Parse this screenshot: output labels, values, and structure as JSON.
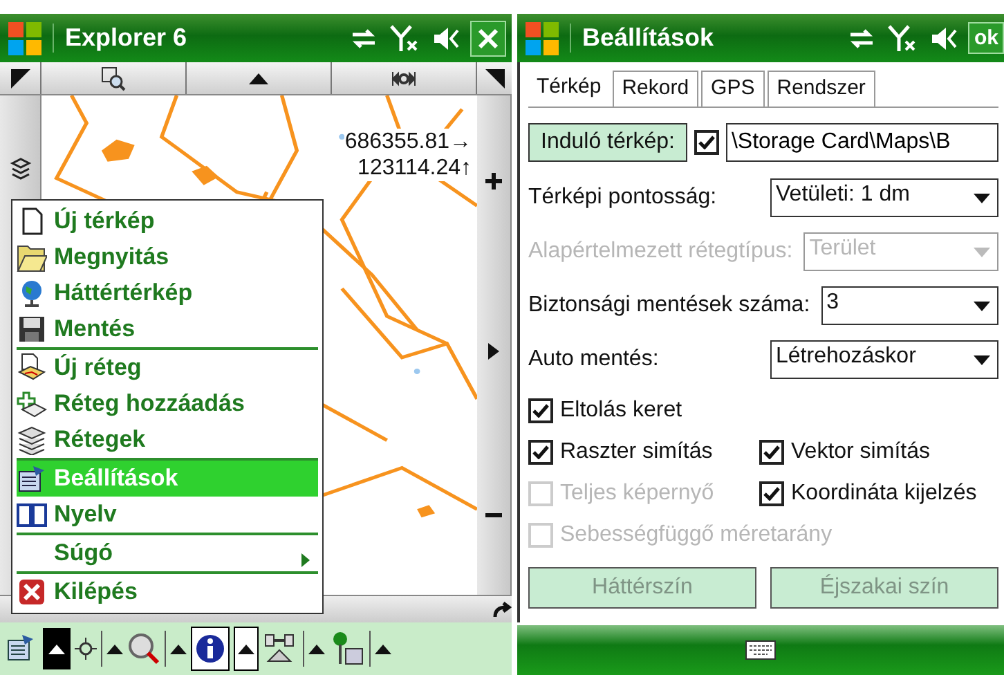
{
  "explorer": {
    "title": "Explorer 6",
    "coordinates": [
      "686355.81→",
      "123114.24↑"
    ],
    "menu": [
      {
        "label": "Új térkép",
        "selected": false,
        "submenu": false,
        "separator_after": false
      },
      {
        "label": "Megnyitás",
        "selected": false,
        "submenu": false,
        "separator_after": false
      },
      {
        "label": "Háttértérkép",
        "selected": false,
        "submenu": false,
        "separator_after": false
      },
      {
        "label": "Mentés",
        "selected": false,
        "submenu": false,
        "separator_after": true
      },
      {
        "label": "Új réteg",
        "selected": false,
        "submenu": false,
        "separator_after": false
      },
      {
        "label": "Réteg hozzáadás",
        "selected": false,
        "submenu": false,
        "separator_after": false
      },
      {
        "label": "Rétegek",
        "selected": false,
        "submenu": false,
        "separator_after": true
      },
      {
        "label": "Beállítások",
        "selected": true,
        "submenu": false,
        "separator_after": false
      },
      {
        "label": "Nyelv",
        "selected": false,
        "submenu": false,
        "separator_after": true
      },
      {
        "label": "Súgó",
        "selected": false,
        "submenu": true,
        "separator_after": true
      },
      {
        "label": "Kilépés",
        "selected": false,
        "submenu": false,
        "separator_after": false
      }
    ]
  },
  "settings": {
    "title": "Beállítások",
    "ok_button": "ok",
    "tabs": [
      {
        "label": "Térkép",
        "selected": true
      },
      {
        "label": "Rekord",
        "selected": false
      },
      {
        "label": "GPS",
        "selected": false
      },
      {
        "label": "Rendszer",
        "selected": false
      }
    ],
    "start_map": {
      "button": "Induló térkép:",
      "checked": true,
      "value": "\\Storage Card\\Maps\\B"
    },
    "dropdowns": [
      {
        "label": "Térképi pontosság:",
        "value": "Vetületi: 1 dm",
        "disabled": false
      },
      {
        "label": "Alapértelmezett rétegtípus:",
        "value": "Terület",
        "disabled": true
      },
      {
        "label": "Biztonsági mentések száma:",
        "value": "3",
        "disabled": false
      },
      {
        "label": "Auto mentés:",
        "value": "Létrehozáskor",
        "disabled": false
      }
    ],
    "checkbox_rows": [
      {
        "items": [
          {
            "label": "Eltolás keret",
            "checked": true,
            "disabled": false
          }
        ]
      },
      {
        "items": [
          {
            "label": "Raszter simítás",
            "checked": true,
            "disabled": false
          },
          {
            "label": "Vektor simítás",
            "checked": true,
            "disabled": false
          }
        ]
      },
      {
        "items": [
          {
            "label": "Teljes képernyő",
            "checked": false,
            "disabled": true
          },
          {
            "label": "Koordináta kijelzés",
            "checked": true,
            "disabled": false
          }
        ]
      },
      {
        "items": [
          {
            "label": "Sebességfüggő méretarány",
            "checked": false,
            "disabled": true
          }
        ]
      }
    ],
    "buttons": [
      {
        "label": "Háttérszín",
        "disabled": true
      },
      {
        "label": "Éjszakai szín",
        "disabled": true
      }
    ]
  }
}
